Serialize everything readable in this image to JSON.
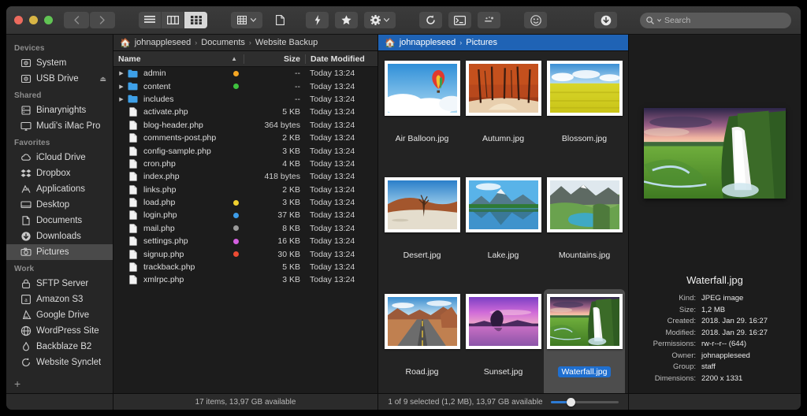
{
  "window": {
    "traffic_lights": [
      "close",
      "minimize",
      "zoom"
    ],
    "colors": {
      "accent": "#1f63b5",
      "selection": "#1f6fd0",
      "window_bg": "#1f1f1f",
      "sidebar_bg": "#262626"
    }
  },
  "toolbar": {
    "back_label": "‹",
    "forward_label": "›",
    "view_modes": [
      {
        "name": "list-view",
        "active": false
      },
      {
        "name": "column-view",
        "active": false
      },
      {
        "name": "icon-view",
        "active": true
      }
    ],
    "buttons": [
      {
        "name": "arrange-button",
        "icon": "grid-icon",
        "caret": true
      },
      {
        "name": "new-document-button",
        "icon": "document-icon"
      },
      {
        "name": "quick-action-button",
        "icon": "bolt-icon"
      },
      {
        "name": "favorite-button",
        "icon": "star-icon"
      },
      {
        "name": "action-menu-button",
        "icon": "gear-icon",
        "caret": true
      },
      {
        "name": "sync-button",
        "icon": "refresh-icon"
      },
      {
        "name": "terminal-button",
        "icon": "terminal-icon"
      },
      {
        "name": "connect-button",
        "icon": "connect-icon"
      },
      {
        "name": "emoji-button",
        "icon": "smiley-icon"
      },
      {
        "name": "download-button",
        "icon": "download-icon"
      }
    ],
    "search": {
      "placeholder": "Search",
      "value": "",
      "icon": "search-icon"
    }
  },
  "sidebar": {
    "groups": [
      {
        "title": "Devices",
        "items": [
          {
            "label": "System",
            "icon": "hard-drive-icon",
            "selected": false,
            "eject": false
          },
          {
            "label": "USB Drive",
            "icon": "hard-drive-icon",
            "selected": false,
            "eject": true,
            "eject_glyph": "⏏"
          }
        ]
      },
      {
        "title": "Shared",
        "items": [
          {
            "label": "Binarynights",
            "icon": "server-icon",
            "selected": false,
            "eject": false
          },
          {
            "label": "Mudi's iMac Pro",
            "icon": "display-icon",
            "selected": false,
            "eject": false
          }
        ]
      },
      {
        "title": "Favorites",
        "items": [
          {
            "label": "iCloud Drive",
            "icon": "cloud-icon",
            "selected": false,
            "eject": false
          },
          {
            "label": "Dropbox",
            "icon": "dropbox-icon",
            "selected": false,
            "eject": false
          },
          {
            "label": "Applications",
            "icon": "applications-icon",
            "selected": false,
            "eject": false
          },
          {
            "label": "Desktop",
            "icon": "desktop-icon",
            "selected": false,
            "eject": false
          },
          {
            "label": "Documents",
            "icon": "documents-icon",
            "selected": false,
            "eject": false
          },
          {
            "label": "Downloads",
            "icon": "downloads-icon",
            "selected": false,
            "eject": false
          },
          {
            "label": "Pictures",
            "icon": "camera-icon",
            "selected": true,
            "eject": false
          }
        ]
      },
      {
        "title": "Work",
        "items": [
          {
            "label": "SFTP Server",
            "icon": "lock-icon",
            "selected": false,
            "eject": false
          },
          {
            "label": "Amazon S3",
            "icon": "amazon-icon",
            "selected": false,
            "eject": false
          },
          {
            "label": "Google Drive",
            "icon": "google-drive-icon",
            "selected": false,
            "eject": false
          },
          {
            "label": "WordPress Site",
            "icon": "globe-icon",
            "selected": false,
            "eject": false
          },
          {
            "label": "Backblaze B2",
            "icon": "flame-icon",
            "selected": false,
            "eject": false
          },
          {
            "label": "Website Synclet",
            "icon": "sync-icon",
            "selected": false,
            "eject": false
          }
        ]
      }
    ],
    "add_label": "+"
  },
  "file_pane": {
    "breadcrumb": {
      "home_icon": "home-icon",
      "parts": [
        "johnappleseed",
        "Documents",
        "Website Backup"
      ],
      "separator": "›"
    },
    "columns": {
      "name": "Name",
      "size": "Size",
      "date": "Date Modified",
      "sort_arrow": "▲"
    },
    "rows": [
      {
        "name": "admin",
        "type": "folder",
        "tag": "#f5a623",
        "size": "--",
        "date": "Today 13:24"
      },
      {
        "name": "content",
        "type": "folder",
        "tag": "#3fc23f",
        "size": "--",
        "date": "Today 13:24"
      },
      {
        "name": "includes",
        "type": "folder",
        "tag": "",
        "size": "--",
        "date": "Today 13:24"
      },
      {
        "name": "activate.php",
        "type": "file",
        "tag": "",
        "size": "5 KB",
        "date": "Today 13:24"
      },
      {
        "name": "blog-header.php",
        "type": "file",
        "tag": "",
        "size": "364 bytes",
        "date": "Today 13:24"
      },
      {
        "name": "comments-post.php",
        "type": "file",
        "tag": "",
        "size": "2 KB",
        "date": "Today 13:24"
      },
      {
        "name": "config-sample.php",
        "type": "file",
        "tag": "",
        "size": "3 KB",
        "date": "Today 13:24"
      },
      {
        "name": "cron.php",
        "type": "file",
        "tag": "",
        "size": "4 KB",
        "date": "Today 13:24"
      },
      {
        "name": "index.php",
        "type": "file",
        "tag": "",
        "size": "418 bytes",
        "date": "Today 13:24"
      },
      {
        "name": "links.php",
        "type": "file",
        "tag": "",
        "size": "2 KB",
        "date": "Today 13:24"
      },
      {
        "name": "load.php",
        "type": "file",
        "tag": "#f0d030",
        "size": "3 KB",
        "date": "Today 13:24"
      },
      {
        "name": "login.php",
        "type": "file",
        "tag": "#3d9ce8",
        "size": "37 KB",
        "date": "Today 13:24"
      },
      {
        "name": "mail.php",
        "type": "file",
        "tag": "#9a9a9a",
        "size": "8 KB",
        "date": "Today 13:24"
      },
      {
        "name": "settings.php",
        "type": "file",
        "tag": "#d45fe0",
        "size": "16 KB",
        "date": "Today 13:24"
      },
      {
        "name": "signup.php",
        "type": "file",
        "tag": "#ec4b33",
        "size": "30 KB",
        "date": "Today 13:24"
      },
      {
        "name": "trackback.php",
        "type": "file",
        "tag": "",
        "size": "5 KB",
        "date": "Today 13:24"
      },
      {
        "name": "xmlrpc.php",
        "type": "file",
        "tag": "",
        "size": "3 KB",
        "date": "Today 13:24"
      }
    ],
    "status": "17 items, 13,97 GB available"
  },
  "grid_pane": {
    "breadcrumb": {
      "home_icon": "home-icon",
      "parts": [
        "johnappleseed",
        "Pictures"
      ],
      "separator": "›"
    },
    "items": [
      {
        "label": "Air Balloon.jpg",
        "thumb": "air-balloon",
        "selected": false
      },
      {
        "label": "Autumn.jpg",
        "thumb": "autumn",
        "selected": false
      },
      {
        "label": "Blossom.jpg",
        "thumb": "blossom",
        "selected": false
      },
      {
        "label": "Desert.jpg",
        "thumb": "desert",
        "selected": false
      },
      {
        "label": "Lake.jpg",
        "thumb": "lake",
        "selected": false
      },
      {
        "label": "Mountains.jpg",
        "thumb": "mountains",
        "selected": false
      },
      {
        "label": "Road.jpg",
        "thumb": "road",
        "selected": false
      },
      {
        "label": "Sunset.jpg",
        "thumb": "sunset",
        "selected": false
      },
      {
        "label": "Waterfall.jpg",
        "thumb": "waterfall",
        "selected": true
      }
    ],
    "status": "1 of 9 selected (1,2 MB), 13,97 GB available",
    "zoom_slider": {
      "value": 25
    }
  },
  "info_pane": {
    "preview_thumb": "waterfall",
    "title": "Waterfall.jpg",
    "meta": [
      {
        "key": "Kind:",
        "value": "JPEG image"
      },
      {
        "key": "Size:",
        "value": "1,2 MB"
      },
      {
        "key": "Created:",
        "value": "2018. Jan 29. 16:27"
      },
      {
        "key": "Modified:",
        "value": "2018. Jan 29. 16:27"
      },
      {
        "key": "Permissions:",
        "value": "rw-r--r-- (644)"
      },
      {
        "key": "Owner:",
        "value": "johnappleseed"
      },
      {
        "key": "Group:",
        "value": "staff"
      },
      {
        "key": "Dimensions:",
        "value": "2200 x 1331"
      }
    ]
  }
}
